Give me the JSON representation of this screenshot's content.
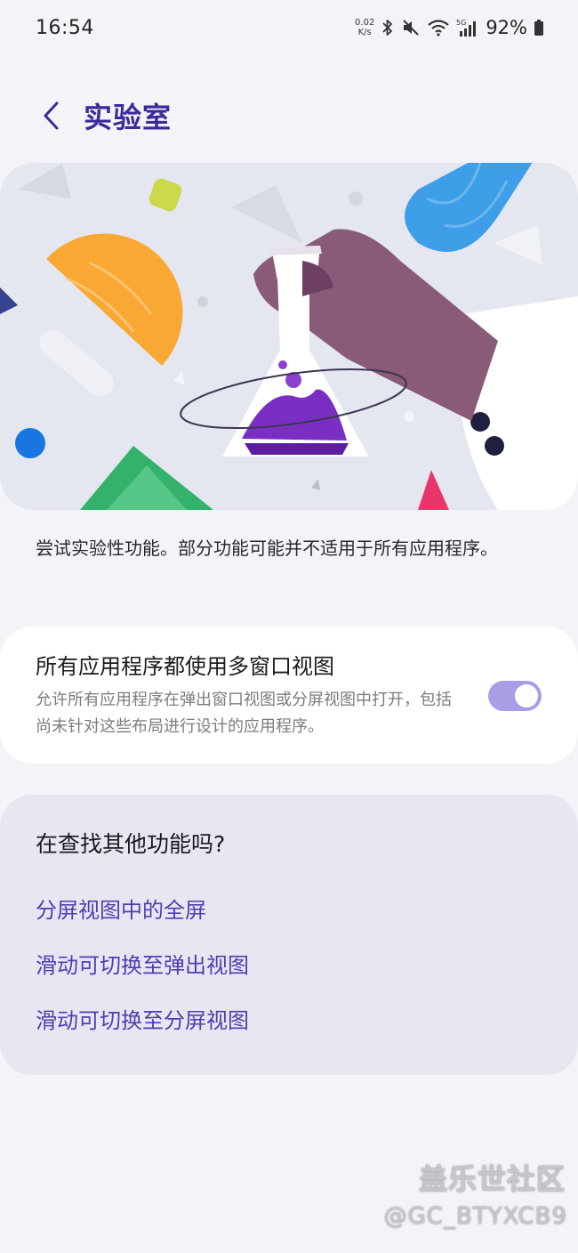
{
  "status_bar": {
    "time": "16:54",
    "net_speed_value": "0.02",
    "net_speed_unit": "K/s",
    "network_badge": "5G",
    "battery_percent": "92%",
    "icons": [
      "bluetooth-icon",
      "mute-icon",
      "wifi-icon",
      "signal-icon",
      "battery-icon"
    ]
  },
  "header": {
    "back_icon": "chevron-left-icon",
    "title": "实验室"
  },
  "hero": {
    "illustration": "lab-flask-illustration"
  },
  "description": "尝试实验性功能。部分功能可能并不适用于所有应用程序。",
  "toggle_setting": {
    "title": "所有应用程序都使用多窗口视图",
    "description": "允许所有应用程序在弹出窗口视图或分屏视图中打开，包括尚未针对这些布局进行设计的应用程序。",
    "enabled": true
  },
  "more_features": {
    "title": "在查找其他功能吗?",
    "links": [
      "分屏视图中的全屏",
      "滑动可切换至弹出视图",
      "滑动可切换至分屏视图"
    ]
  },
  "watermark": {
    "name": "盖乐世社区",
    "user": "@GC_BTYXCB9"
  },
  "colors": {
    "title": "#3d2a9b",
    "link": "#4e3fb3",
    "switch_on": "#a99de6",
    "background": "#f4f3f7"
  }
}
